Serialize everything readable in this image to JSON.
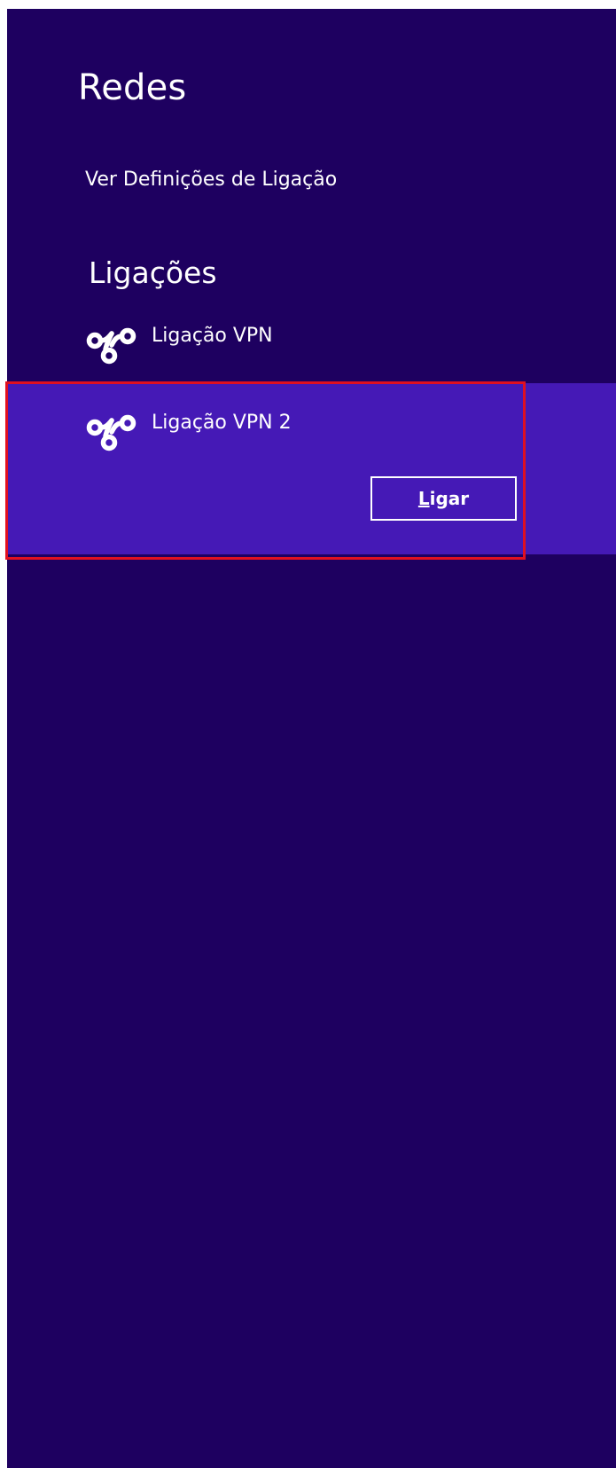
{
  "panel": {
    "title": "Redes",
    "settings_link": "Ver Definições de Ligação",
    "connections_heading": "Ligações",
    "background_color": "#1e0060",
    "selected_color": "#4519b6",
    "highlight_color": "#e01020"
  },
  "connections": [
    {
      "name": "Ligação VPN",
      "icon": "vpn-icon",
      "selected": false
    },
    {
      "name": "Ligação VPN 2",
      "icon": "vpn-icon",
      "selected": true,
      "button": {
        "access_key": "L",
        "rest": "igar"
      }
    }
  ]
}
